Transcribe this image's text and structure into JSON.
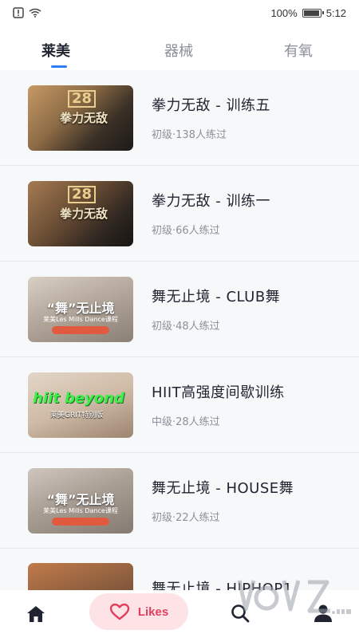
{
  "status_bar": {
    "battery_text": "100%",
    "battery_level": 1.0,
    "time": "5:12"
  },
  "tabs": [
    {
      "label": "莱美",
      "active": true
    },
    {
      "label": "器械",
      "active": false
    },
    {
      "label": "有氧",
      "active": false
    }
  ],
  "courses": [
    {
      "title": "拳力无敌 - 训练五",
      "meta": "初级·138人练过",
      "thumb_text": "拳力无敌",
      "thumb_num": "28"
    },
    {
      "title": "拳力无敌 - 训练一",
      "meta": "初级·66人练过",
      "thumb_text": "拳力无敌",
      "thumb_num": "28"
    },
    {
      "title": "舞无止境 - CLUB舞",
      "meta": "初级·48人练过",
      "thumb_text": "“舞”无止境",
      "thumb_sub": "莱美Les Mills Dance课程"
    },
    {
      "title": "HIIT高强度间歇训练",
      "meta": "中级·28人练过",
      "thumb_text": "hiit beyond",
      "thumb_sub": "莱美GRIT特别版"
    },
    {
      "title": "舞无止境 - HOUSE舞",
      "meta": "初级·22人练过",
      "thumb_text": "“舞”无止境",
      "thumb_sub": "莱美Les Mills Dance课程"
    },
    {
      "title": "舞无止境 - HIPHOP1",
      "meta": "",
      "thumb_text": "",
      "thumb_sub": ""
    }
  ],
  "bottom_nav": {
    "likes_label": "Likes",
    "icons": [
      "home-icon",
      "heart-icon",
      "search-icon",
      "profile-icon"
    ]
  },
  "colors": {
    "accent": "#2f7df6",
    "likes_bg": "#fde3e6",
    "likes_fg": "#e0405e"
  }
}
